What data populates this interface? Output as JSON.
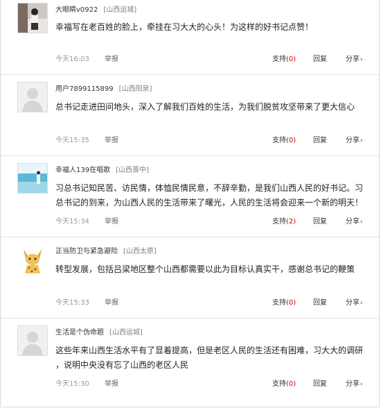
{
  "comments": [
    {
      "user": "大眼睛v0922",
      "location": "[山西运城]",
      "text": "幸福写在老百姓的脸上，牵挂在习大大的心头！为这样的好书记点赞！",
      "time": "今天16:03",
      "support_count": "0",
      "avatar": "photo-avatar"
    },
    {
      "user": "用户7899115899",
      "location": "[山西阳泉]",
      "text": "总书记走进田间地头，深入了解我们百姓的生活，为我们脱贫攻坚带来了更大信心",
      "time": "今天15:35",
      "support_count": "0",
      "avatar": "default-avatar"
    },
    {
      "user": "幸福人139在唱歌",
      "location": "[山西晋中]",
      "text": "习总书记知民苦、访民情，体恤民情民意，不辞辛勤，是我们山西人民的好书记。习总书记的到来，为山西人民的生活带来了曙光，人民的生活将会迎来一个新的明天！",
      "time": "今天15:34",
      "support_count": "2",
      "avatar": "beach-avatar"
    },
    {
      "user": "正当防卫与紧急避险",
      "location": "[山西太原]",
      "text": "转型发展，包括吕梁地区整个山西都需要以此为目标认真实干，感谢总书记的鞭策",
      "time": "今天15:33",
      "support_count": "0",
      "avatar": "serval-cat-avatar"
    },
    {
      "user": "生活是个伪命题",
      "location": "[山西运城]",
      "text": "这些年来山西生活水平有了显着提高，但是老区人民的生活还有困难，习大大的调研  ，说明中央没有忘了山西的老区人民",
      "time": "今天15:30",
      "support_count": "0",
      "avatar": "default-avatar"
    }
  ],
  "labels": {
    "report": "举报",
    "support": "支持",
    "reply": "回复",
    "share": "分享",
    "share_arrow": "›"
  },
  "colors": {
    "support_count": "#d40000",
    "divider": "#e3e3e3",
    "muted_text": "#999999"
  }
}
